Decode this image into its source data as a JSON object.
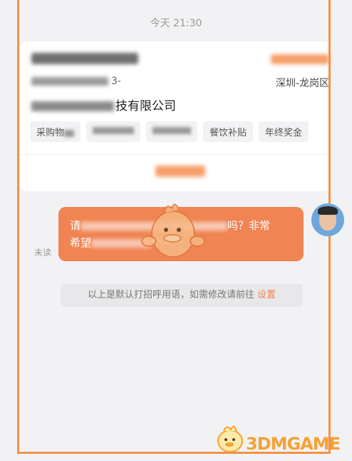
{
  "chat": {
    "timestamp": "今天 21:30"
  },
  "job_card": {
    "info_suffix": "3-",
    "location": "深圳-龙岗区",
    "company_suffix": "技有限公司",
    "tags": [
      "采购物",
      "",
      "",
      "餐饮补贴",
      "年终奖金"
    ]
  },
  "message": {
    "unread_label": "未读",
    "line1_prefix": "请",
    "line1_suffix": "吗？非常",
    "line2_prefix": "希望",
    "line2_suffix": "个~"
  },
  "notice": {
    "text": "以上是默认打招呼用语，如需修改请前往",
    "link": "设置"
  },
  "watermark": {
    "text": "3DMGAME"
  },
  "colors": {
    "accent": "#f08453",
    "frame": "#f39148",
    "background": "#f2f2f4"
  }
}
